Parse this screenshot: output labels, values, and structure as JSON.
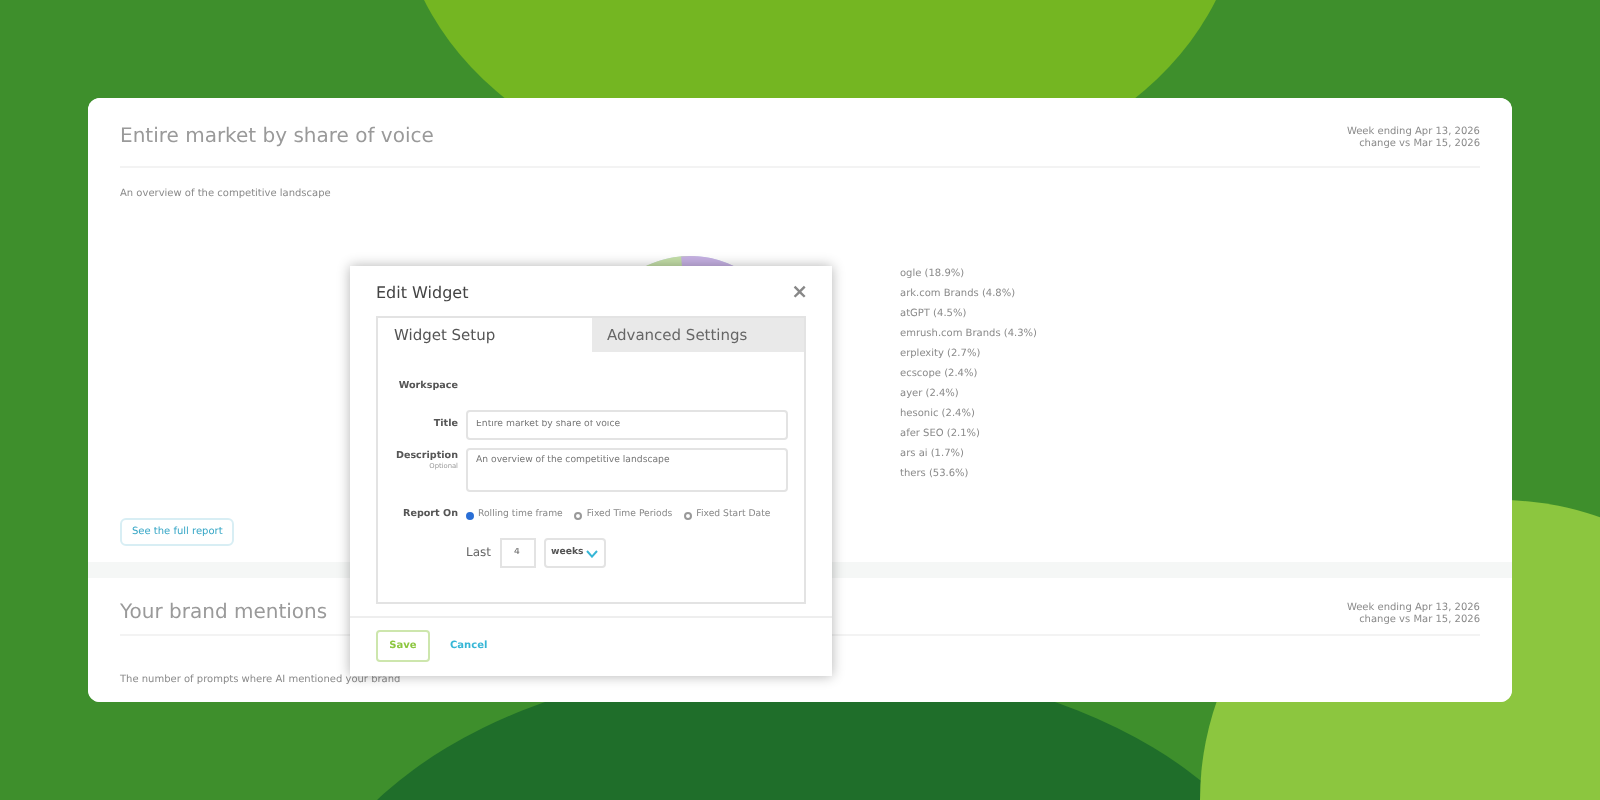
{
  "report_card": {
    "title": "Entire market by share of voice",
    "subtitle": "An overview of the competitive landscape",
    "period": [
      "Week ending Apr 13, 2026",
      "change vs Mar 15, 2026"
    ],
    "legend": [
      "ogle (18.9%)",
      "ark.com Brands (4.8%)",
      "atGPT (4.5%)",
      "emrush.com Brands (4.3%)",
      "erplexity (2.7%)",
      "ecscope (2.4%)",
      "ayer (2.4%)",
      "hesonic (2.4%)",
      "afer SEO (2.1%)",
      "ars ai (1.7%)",
      "thers (53.6%)"
    ],
    "link": "See the full report"
  },
  "mentions_card": {
    "title": "Your brand mentions",
    "subtitle": "The number of prompts where AI mentioned your brand",
    "period": [
      "Week ending Apr 13, 2026",
      "change vs Mar 15, 2026"
    ]
  },
  "dialog": {
    "title": "Edit Widget",
    "close": "×",
    "tabs": [
      {
        "label": "Widget Setup",
        "selected": true
      },
      {
        "label": "Advanced Settings",
        "selected": false
      }
    ],
    "workspace_label": "Workspace",
    "title_label": "Title",
    "title_value": "Entire market by share of voice",
    "description_label": "Description",
    "description_hint": "Optional",
    "description_value": "An overview of the competitive landscape",
    "report_on_label": "Report On",
    "report_options": [
      {
        "label": "Rolling time frame",
        "selected": true
      },
      {
        "label": "Fixed Time Periods",
        "selected": false
      },
      {
        "label": "Fixed Start Date",
        "selected": false
      }
    ],
    "last_label": "Last",
    "last_value": "4",
    "unit": "weeks",
    "save": "Save",
    "cancel": "Cancel"
  }
}
